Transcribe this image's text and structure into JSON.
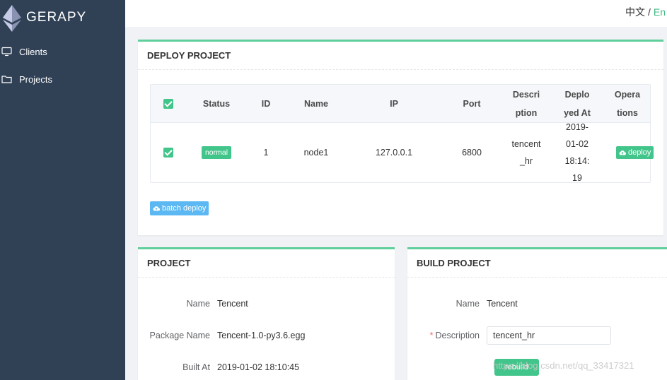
{
  "app": {
    "brand": "GERAPY"
  },
  "sidebar": {
    "items": [
      {
        "label": "Clients",
        "icon": "monitor-icon"
      },
      {
        "label": "Projects",
        "icon": "folder-icon"
      }
    ]
  },
  "topbar": {
    "lang_zh": "中文",
    "separator": "/",
    "lang_en": "En"
  },
  "deploy": {
    "title": "DEPLOY PROJECT",
    "columns": {
      "status": "Status",
      "id": "ID",
      "name": "Name",
      "ip": "IP",
      "port": "Port",
      "description": "Description",
      "deployed_at": "Deployed At",
      "operations": "Operations"
    },
    "rows": [
      {
        "checked": true,
        "status": "normal",
        "id": "1",
        "name": "node1",
        "ip": "127.0.0.1",
        "port": "6800",
        "description": "tencent_hr",
        "deployed_at": "2019-01-02 18:14:19",
        "action": "deploy"
      }
    ],
    "batch_label": "batch deploy"
  },
  "project": {
    "title": "PROJECT",
    "name_label": "Name",
    "name_value": "Tencent",
    "package_label": "Package Name",
    "package_value": "Tencent-1.0-py3.6.egg",
    "built_label": "Built At",
    "built_value": "2019-01-02 18:10:45"
  },
  "build": {
    "title": "BUILD PROJECT",
    "name_label": "Name",
    "name_value": "Tencent",
    "desc_label": "Description",
    "desc_required": "*",
    "desc_value": "tencent_hr",
    "build_label": "rebuild"
  },
  "watermark": "https://blog.csdn.net/qq_33417321",
  "colors": {
    "sidebar": "#304156",
    "accent": "#42c58a",
    "batch": "#5bb8f2",
    "lang_active": "#42b983"
  }
}
